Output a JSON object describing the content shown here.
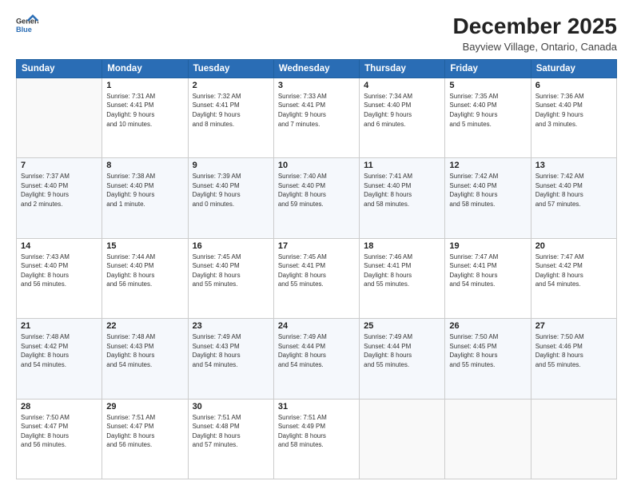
{
  "header": {
    "logo_line1": "General",
    "logo_line2": "Blue",
    "month": "December 2025",
    "location": "Bayview Village, Ontario, Canada"
  },
  "weekdays": [
    "Sunday",
    "Monday",
    "Tuesday",
    "Wednesday",
    "Thursday",
    "Friday",
    "Saturday"
  ],
  "weeks": [
    [
      {
        "day": "",
        "info": ""
      },
      {
        "day": "1",
        "info": "Sunrise: 7:31 AM\nSunset: 4:41 PM\nDaylight: 9 hours\nand 10 minutes."
      },
      {
        "day": "2",
        "info": "Sunrise: 7:32 AM\nSunset: 4:41 PM\nDaylight: 9 hours\nand 8 minutes."
      },
      {
        "day": "3",
        "info": "Sunrise: 7:33 AM\nSunset: 4:41 PM\nDaylight: 9 hours\nand 7 minutes."
      },
      {
        "day": "4",
        "info": "Sunrise: 7:34 AM\nSunset: 4:40 PM\nDaylight: 9 hours\nand 6 minutes."
      },
      {
        "day": "5",
        "info": "Sunrise: 7:35 AM\nSunset: 4:40 PM\nDaylight: 9 hours\nand 5 minutes."
      },
      {
        "day": "6",
        "info": "Sunrise: 7:36 AM\nSunset: 4:40 PM\nDaylight: 9 hours\nand 3 minutes."
      }
    ],
    [
      {
        "day": "7",
        "info": "Sunrise: 7:37 AM\nSunset: 4:40 PM\nDaylight: 9 hours\nand 2 minutes."
      },
      {
        "day": "8",
        "info": "Sunrise: 7:38 AM\nSunset: 4:40 PM\nDaylight: 9 hours\nand 1 minute."
      },
      {
        "day": "9",
        "info": "Sunrise: 7:39 AM\nSunset: 4:40 PM\nDaylight: 9 hours\nand 0 minutes."
      },
      {
        "day": "10",
        "info": "Sunrise: 7:40 AM\nSunset: 4:40 PM\nDaylight: 8 hours\nand 59 minutes."
      },
      {
        "day": "11",
        "info": "Sunrise: 7:41 AM\nSunset: 4:40 PM\nDaylight: 8 hours\nand 58 minutes."
      },
      {
        "day": "12",
        "info": "Sunrise: 7:42 AM\nSunset: 4:40 PM\nDaylight: 8 hours\nand 58 minutes."
      },
      {
        "day": "13",
        "info": "Sunrise: 7:42 AM\nSunset: 4:40 PM\nDaylight: 8 hours\nand 57 minutes."
      }
    ],
    [
      {
        "day": "14",
        "info": "Sunrise: 7:43 AM\nSunset: 4:40 PM\nDaylight: 8 hours\nand 56 minutes."
      },
      {
        "day": "15",
        "info": "Sunrise: 7:44 AM\nSunset: 4:40 PM\nDaylight: 8 hours\nand 56 minutes."
      },
      {
        "day": "16",
        "info": "Sunrise: 7:45 AM\nSunset: 4:40 PM\nDaylight: 8 hours\nand 55 minutes."
      },
      {
        "day": "17",
        "info": "Sunrise: 7:45 AM\nSunset: 4:41 PM\nDaylight: 8 hours\nand 55 minutes."
      },
      {
        "day": "18",
        "info": "Sunrise: 7:46 AM\nSunset: 4:41 PM\nDaylight: 8 hours\nand 55 minutes."
      },
      {
        "day": "19",
        "info": "Sunrise: 7:47 AM\nSunset: 4:41 PM\nDaylight: 8 hours\nand 54 minutes."
      },
      {
        "day": "20",
        "info": "Sunrise: 7:47 AM\nSunset: 4:42 PM\nDaylight: 8 hours\nand 54 minutes."
      }
    ],
    [
      {
        "day": "21",
        "info": "Sunrise: 7:48 AM\nSunset: 4:42 PM\nDaylight: 8 hours\nand 54 minutes."
      },
      {
        "day": "22",
        "info": "Sunrise: 7:48 AM\nSunset: 4:43 PM\nDaylight: 8 hours\nand 54 minutes."
      },
      {
        "day": "23",
        "info": "Sunrise: 7:49 AM\nSunset: 4:43 PM\nDaylight: 8 hours\nand 54 minutes."
      },
      {
        "day": "24",
        "info": "Sunrise: 7:49 AM\nSunset: 4:44 PM\nDaylight: 8 hours\nand 54 minutes."
      },
      {
        "day": "25",
        "info": "Sunrise: 7:49 AM\nSunset: 4:44 PM\nDaylight: 8 hours\nand 55 minutes."
      },
      {
        "day": "26",
        "info": "Sunrise: 7:50 AM\nSunset: 4:45 PM\nDaylight: 8 hours\nand 55 minutes."
      },
      {
        "day": "27",
        "info": "Sunrise: 7:50 AM\nSunset: 4:46 PM\nDaylight: 8 hours\nand 55 minutes."
      }
    ],
    [
      {
        "day": "28",
        "info": "Sunrise: 7:50 AM\nSunset: 4:47 PM\nDaylight: 8 hours\nand 56 minutes."
      },
      {
        "day": "29",
        "info": "Sunrise: 7:51 AM\nSunset: 4:47 PM\nDaylight: 8 hours\nand 56 minutes."
      },
      {
        "day": "30",
        "info": "Sunrise: 7:51 AM\nSunset: 4:48 PM\nDaylight: 8 hours\nand 57 minutes."
      },
      {
        "day": "31",
        "info": "Sunrise: 7:51 AM\nSunset: 4:49 PM\nDaylight: 8 hours\nand 58 minutes."
      },
      {
        "day": "",
        "info": ""
      },
      {
        "day": "",
        "info": ""
      },
      {
        "day": "",
        "info": ""
      }
    ]
  ]
}
